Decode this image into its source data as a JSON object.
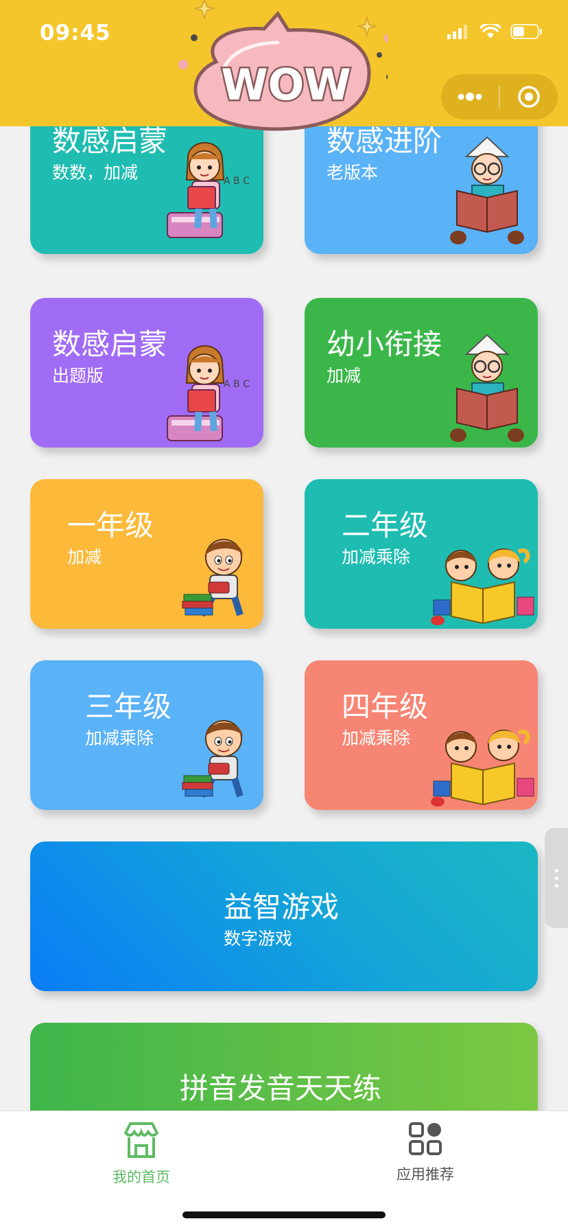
{
  "status_bar": {
    "time": "09:45"
  },
  "header": {
    "sticker_text": "WOW",
    "bg_color": "#f4c62b"
  },
  "cards": [
    {
      "title": "数感启蒙",
      "subtitle": "数数，加减",
      "color": "#1fbcb1",
      "art": "girl-reading-icon"
    },
    {
      "title": "数感进阶",
      "subtitle": "老版本",
      "color": "#5ab2f7",
      "art": "boy-reading-book-icon"
    },
    {
      "title": "数感启蒙",
      "subtitle": "出题版",
      "color": "#a06cf5",
      "art": "girl-reading-icon"
    },
    {
      "title": "幼小衔接",
      "subtitle": "加减",
      "color": "#3bb74a",
      "art": "boy-reading-book-icon"
    },
    {
      "title": "一年级",
      "subtitle": "加减",
      "color": "#fcb93a",
      "art": "boy-with-books-icon"
    },
    {
      "title": "二年级",
      "subtitle": "加减乘除",
      "color": "#1fbcb1",
      "art": "kids-reading-icon"
    },
    {
      "title": "三年级",
      "subtitle": "加减乘除",
      "color": "#5ab2f7",
      "art": "boy-with-books-icon"
    },
    {
      "title": "四年级",
      "subtitle": "加减乘除",
      "color": "#f78574",
      "art": "kids-reading-icon"
    }
  ],
  "wide_cards": [
    {
      "title": "益智游戏",
      "subtitle": "数字游戏"
    },
    {
      "title": "拼音发音天天练"
    }
  ],
  "tabbar": {
    "items": [
      {
        "label": "我的首页",
        "icon": "storefront-icon",
        "active": true,
        "color": "#5dbb63"
      },
      {
        "label": "应用推荐",
        "icon": "grid-apps-icon",
        "active": false,
        "color": "#555555"
      }
    ]
  }
}
